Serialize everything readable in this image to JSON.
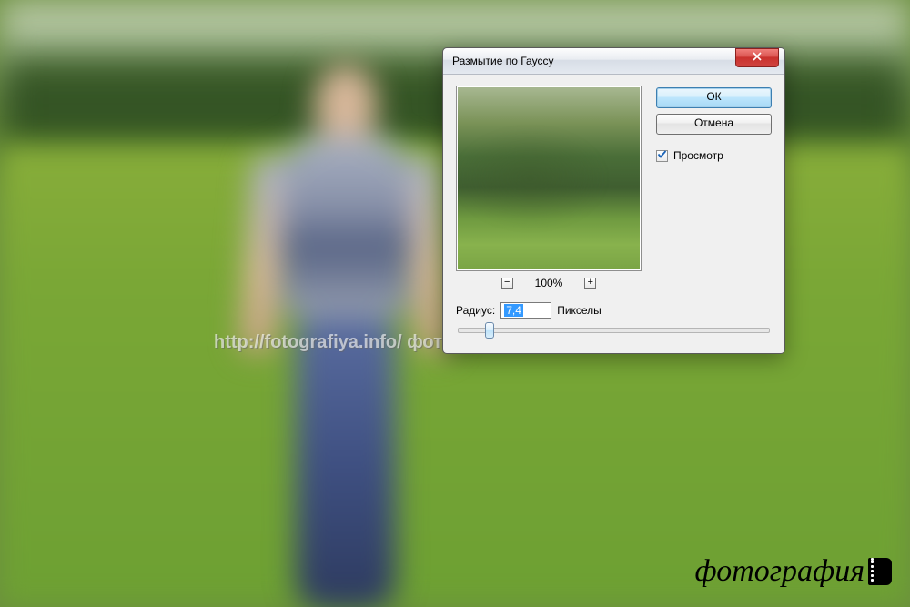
{
  "dialog": {
    "title": "Размытие по Гауссу",
    "ok_label": "ОК",
    "cancel_label": "Отмена",
    "preview_label": "Просмотр",
    "preview_checked": true,
    "zoom_level": "100%",
    "zoom_out_glyph": "−",
    "zoom_in_glyph": "+",
    "radius_label": "Радиус:",
    "radius_value": "7,4",
    "radius_unit": "Пикселы",
    "slider_percent": 10
  },
  "watermark": {
    "url_text": "http://fotografiya.info/  фотография.инфо",
    "logo_text": "фотография"
  }
}
